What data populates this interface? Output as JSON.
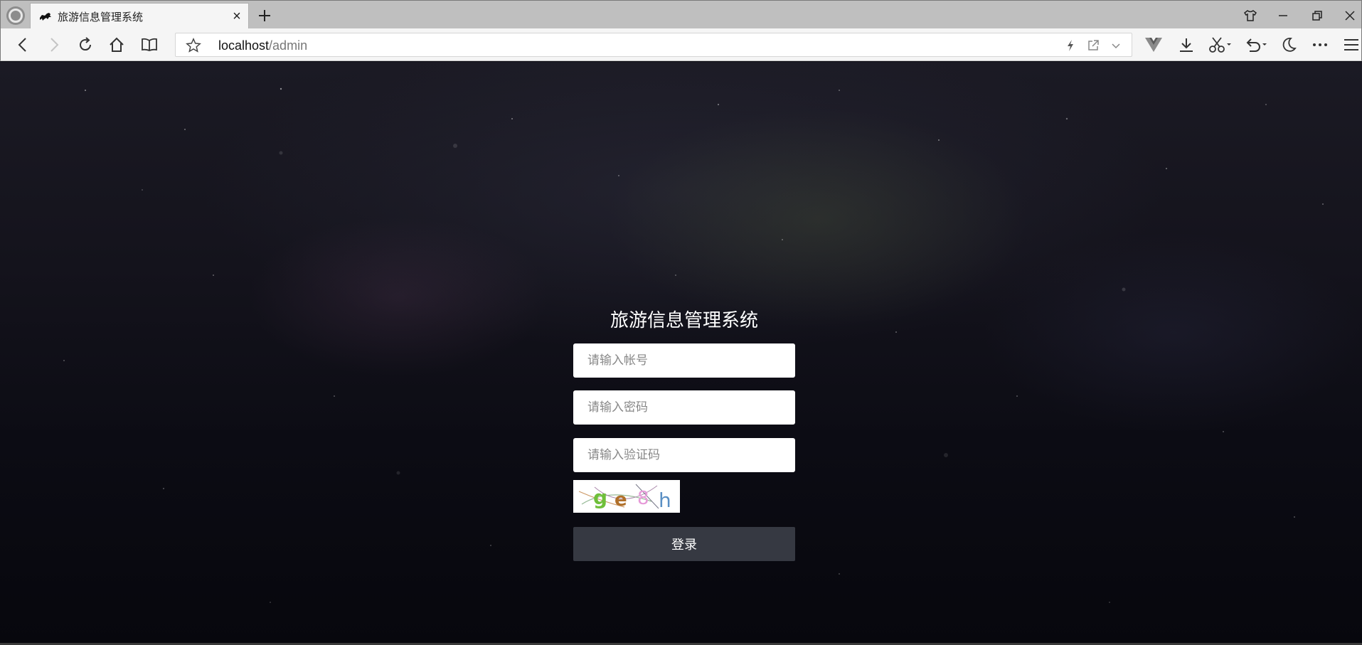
{
  "browser": {
    "tab_title": "旅游信息管理系统",
    "tab_close": "×",
    "url_host": "localhost",
    "url_path": "/admin"
  },
  "icons": {
    "app_logo": "browser-logo-icon",
    "favicon": "horse-icon",
    "new_tab": "plus-icon",
    "back": "back-arrow-icon",
    "forward": "forward-arrow-icon",
    "reload": "reload-icon",
    "home": "home-icon",
    "reader": "book-icon",
    "bookmark": "star-icon",
    "lightning": "lightning-icon",
    "share": "share-icon",
    "dropdown": "chevron-down-icon",
    "extension": "vue-devtools-icon",
    "download": "download-icon",
    "screenshot": "scissors-icon",
    "undo": "undo-icon",
    "night": "moon-icon",
    "more": "more-dots-icon",
    "menu": "hamburger-icon",
    "theme": "shirt-icon"
  },
  "login": {
    "title": "旅游信息管理系统",
    "username_placeholder": "请输入帐号",
    "password_placeholder": "请输入密码",
    "captcha_placeholder": "请输入验证码",
    "captcha_chars": [
      "g",
      "e",
      "8",
      "h"
    ],
    "captcha_colors": [
      "#6fbf3a",
      "#b0702a",
      "#e69ad8",
      "#5a8fc4"
    ],
    "submit_label": "登录"
  },
  "colors": {
    "button_bg": "#363942",
    "background_dark": "#0b0b12"
  }
}
